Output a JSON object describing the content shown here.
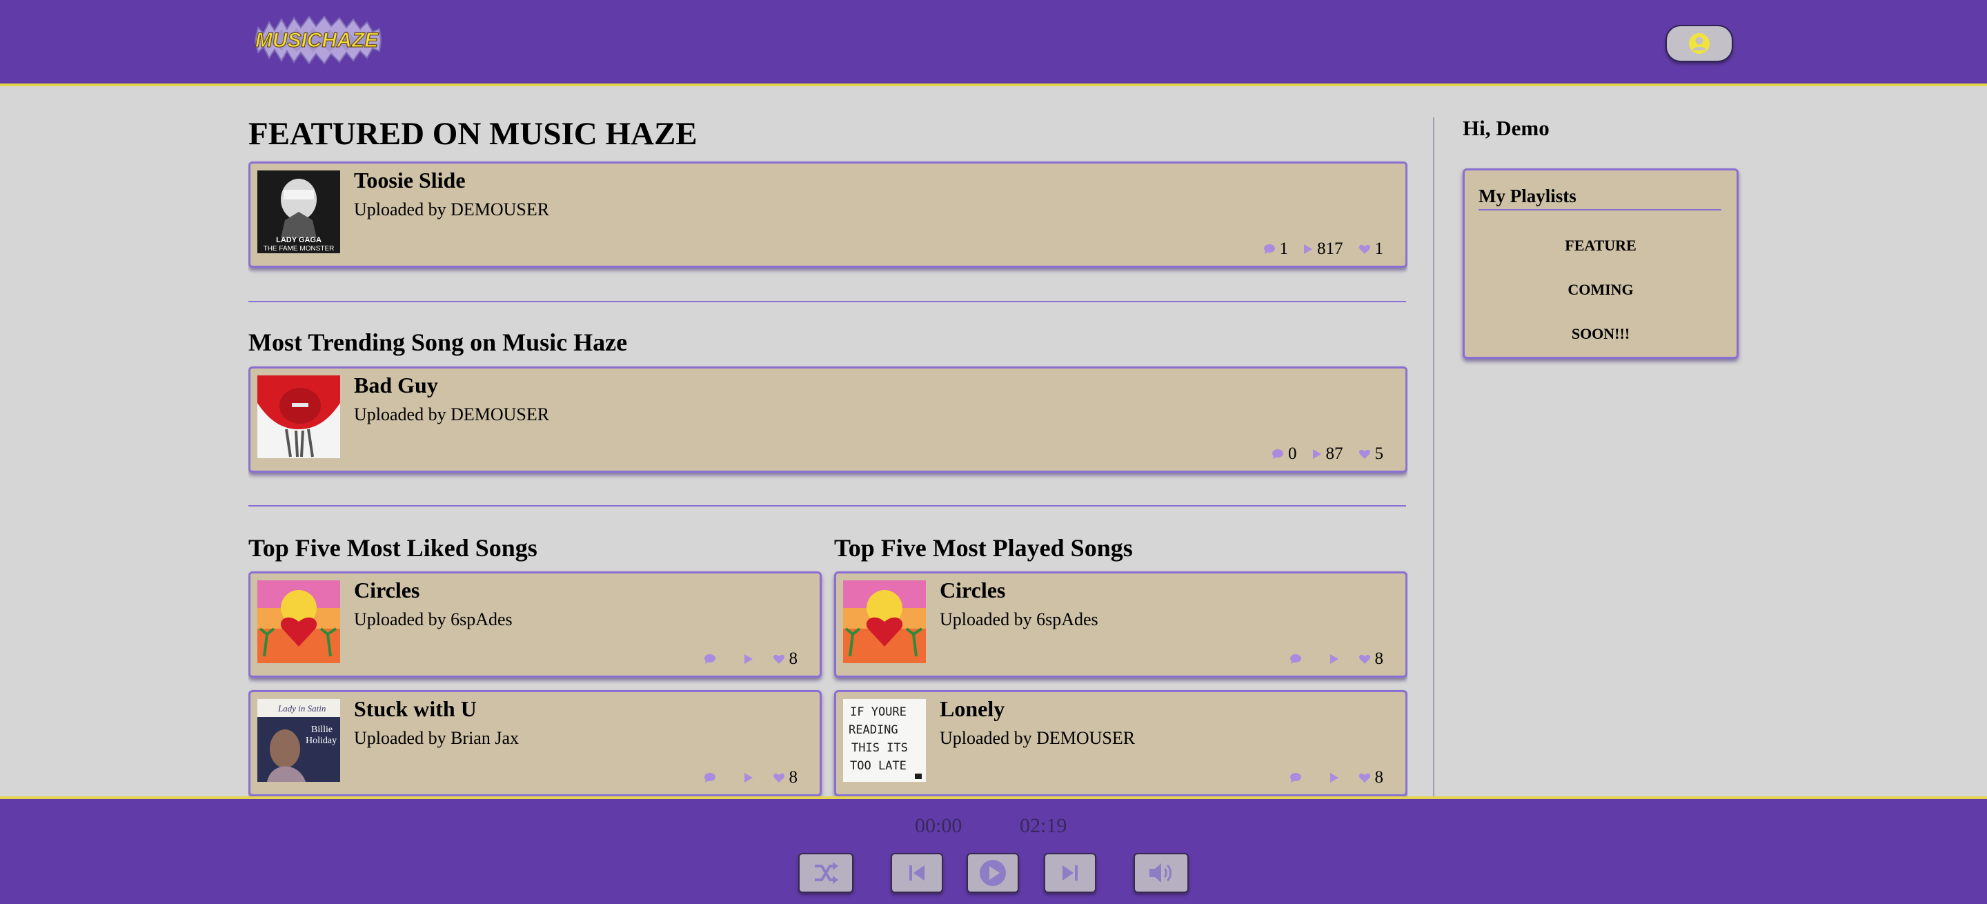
{
  "header": {
    "logo_text": "MUSICHAZE"
  },
  "featured": {
    "title": "FEATURED ON MUSIC HAZE",
    "song": {
      "name": "Toosie Slide",
      "uploader": "Uploaded by DEMOUSER",
      "comments": "1",
      "plays": "817",
      "likes": "1",
      "art": "lady-gaga-fame-monster-cover",
      "art_text": "LADY GAGA\nTHE FAME MONSTER"
    }
  },
  "trending": {
    "title": "Most Trending Song on Music Haze",
    "song": {
      "name": "Bad Guy",
      "uploader": "Uploaded by DEMOUSER",
      "comments": "0",
      "plays": "87",
      "likes": "5",
      "art": "red-hair-cover"
    }
  },
  "top_liked": {
    "title": "Top Five Most Liked Songs",
    "songs": [
      {
        "name": "Circles",
        "uploader": "Uploaded by 6spAdes",
        "comments": "",
        "plays": "",
        "likes": "8",
        "art": "bad-bunny-heart-cover"
      },
      {
        "name": "Stuck with U",
        "uploader": "Uploaded by Brian Jax",
        "comments": "",
        "plays": "",
        "likes": "8",
        "art": "lady-in-satin-cover",
        "art_text": "Lady in Satin\nBillie\nHoliday"
      }
    ]
  },
  "top_played": {
    "title": "Top Five Most Played Songs",
    "songs": [
      {
        "name": "Circles",
        "uploader": "Uploaded by 6spAdes",
        "comments": "",
        "plays": "",
        "likes": "8",
        "art": "bad-bunny-heart-cover"
      },
      {
        "name": "Lonely",
        "uploader": "Uploaded by DEMOUSER",
        "comments": "",
        "plays": "",
        "likes": "8",
        "art": "drake-if-youre-reading-cover",
        "art_text": "IF YOURE\nREADING\nTHIS ITS\nTOO LATE"
      }
    ]
  },
  "sidebar": {
    "greeting": "Hi, Demo",
    "playlists_title": "My Playlists",
    "playlist_items": [
      "FEATURE",
      "COMING",
      "SOON!!!"
    ]
  },
  "player": {
    "current_time": "00:00",
    "duration": "02:19",
    "controls": [
      "shuffle-icon",
      "previous-icon",
      "play-icon",
      "next-icon",
      "volume-icon"
    ]
  },
  "colors": {
    "bar": "#613ca8",
    "accent_line": "#e4d54c",
    "card": "#cec1a6",
    "card_border": "#8a6fd2",
    "icon": "#a98be0",
    "background": "#d6d6d6"
  }
}
